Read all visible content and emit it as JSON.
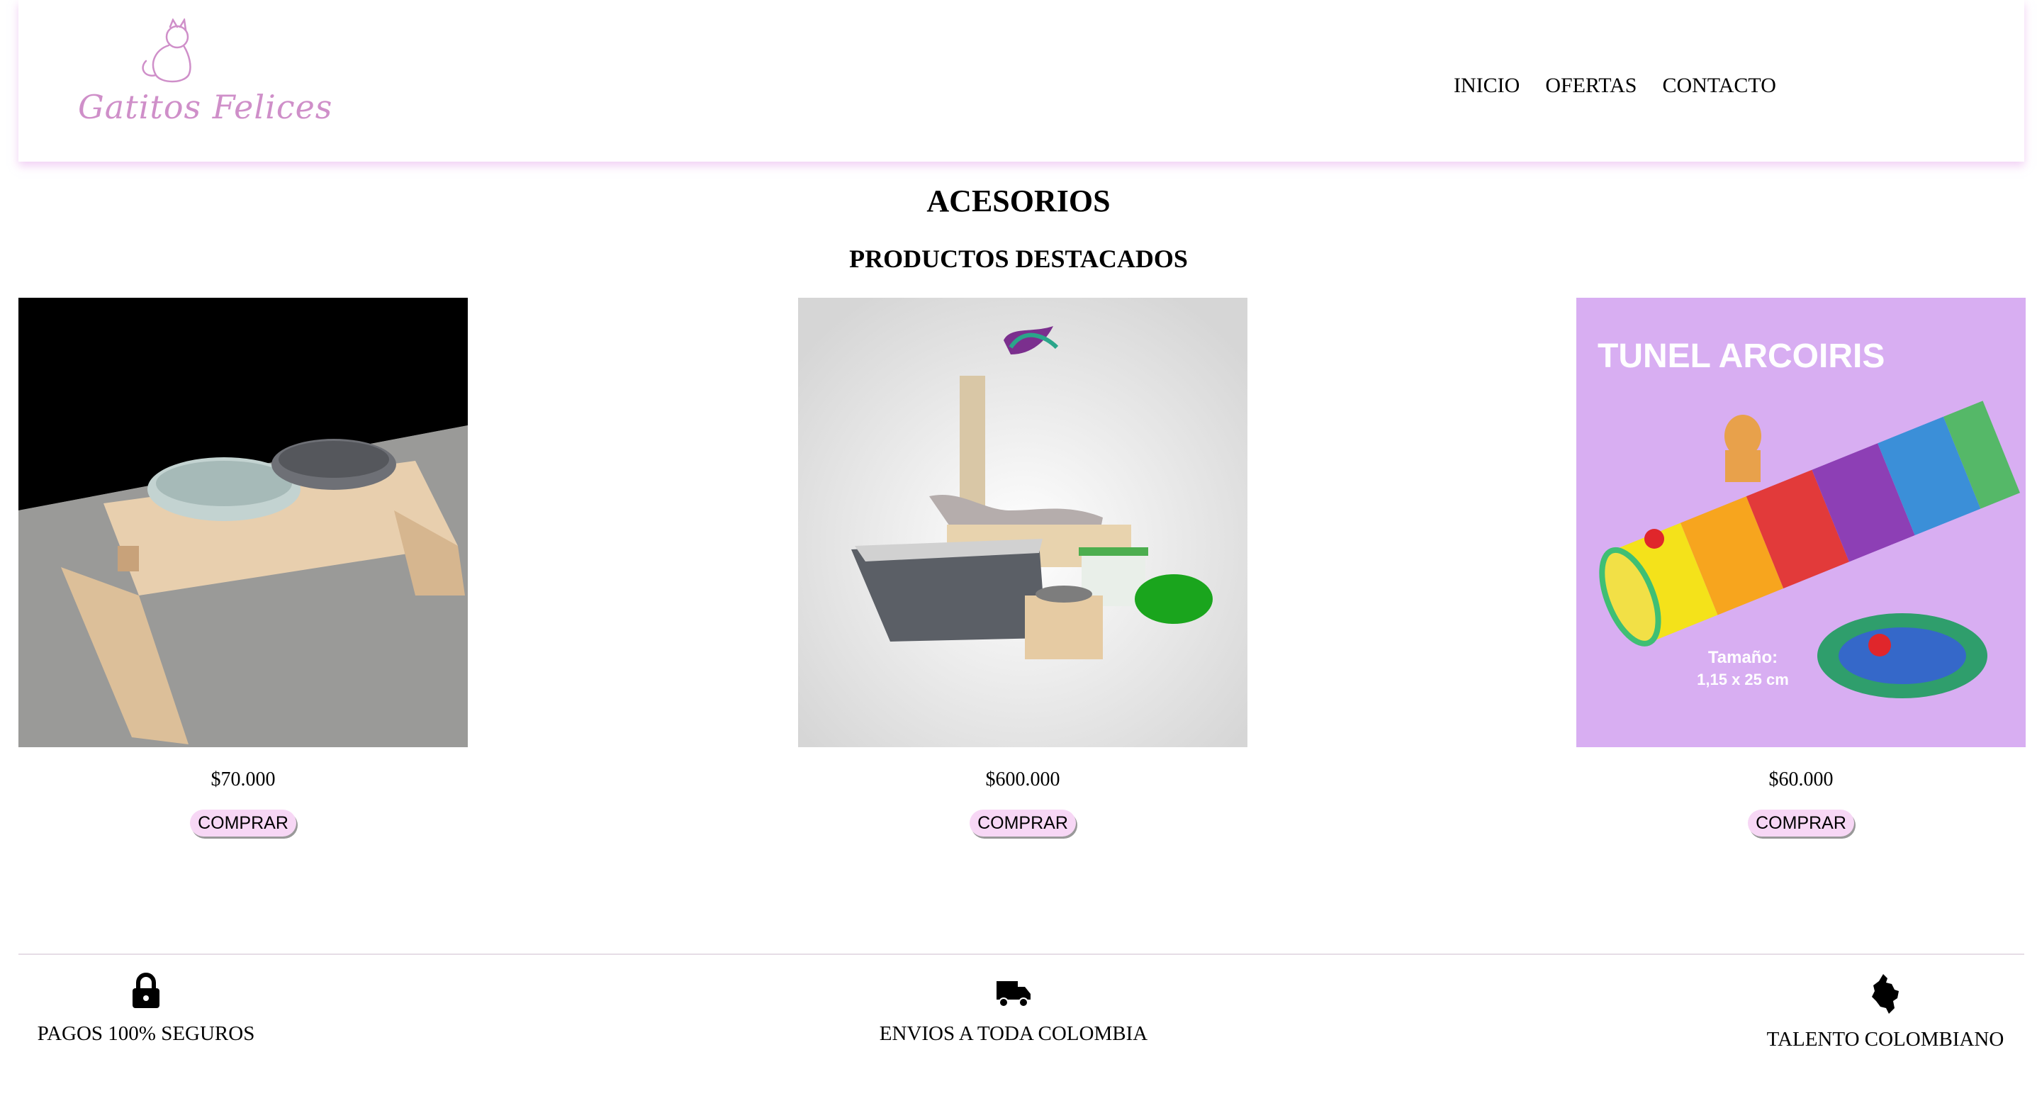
{
  "header": {
    "logo_text": "Gatitos Felices",
    "nav": [
      "INICIO",
      "OFERTAS",
      "CONTACTO"
    ]
  },
  "page": {
    "title": "ACESORIOS",
    "subtitle": "PRODUCTOS DESTACADOS"
  },
  "products": [
    {
      "price": "$70.000",
      "button": "COMPRAR"
    },
    {
      "price": "$600.000",
      "button": "COMPRAR"
    },
    {
      "price": "$60.000",
      "button": "COMPRAR",
      "image_text": "TUNEL ARCOIRIS",
      "image_caption_1": "Tamaño:",
      "image_caption_2": "1,15 x 25 cm"
    }
  ],
  "features": [
    {
      "label": "PAGOS 100% SEGUROS",
      "icon": "lock-icon"
    },
    {
      "label": "ENVIOS A TODA COLOMBIA",
      "icon": "truck-icon"
    },
    {
      "label": "TALENTO COLOMBIANO",
      "icon": "colombia-map-icon"
    }
  ],
  "colors": {
    "logo": "#cf8fc9",
    "button_bg": "#f7d7f5",
    "header_shadow": "#e6aaeb",
    "tunnel_bg": "#d8aef2"
  }
}
